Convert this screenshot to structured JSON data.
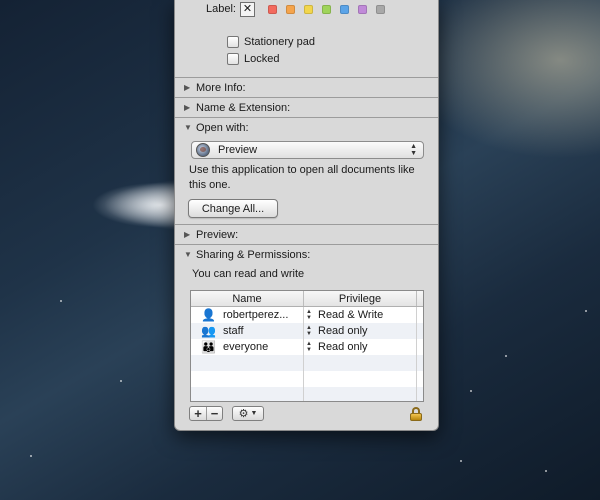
{
  "general": {
    "label_text": "Label:",
    "label_none_glyph": "✕",
    "label_colors": [
      "#f36a5e",
      "#f5a44c",
      "#f2d64c",
      "#9fd45a",
      "#5ba4e8",
      "#c08ad8",
      "#a8a8a8"
    ],
    "stationery_pad": "Stationery pad",
    "locked": "Locked"
  },
  "sections": {
    "more_info": "More Info:",
    "name_extension": "Name & Extension:",
    "open_with": "Open with:",
    "preview": "Preview:",
    "sharing": "Sharing & Permissions:"
  },
  "open_with": {
    "app": "Preview",
    "description": "Use this application to open all documents like this one.",
    "change_all": "Change All..."
  },
  "sharing": {
    "status": "You can read and write",
    "columns": [
      "Name",
      "Privilege"
    ],
    "rows": [
      {
        "name": "robertperez...",
        "privilege": "Read & Write",
        "icon": "single-user-icon"
      },
      {
        "name": "staff",
        "privilege": "Read only",
        "icon": "group-icon"
      },
      {
        "name": "everyone",
        "privilege": "Read only",
        "icon": "everyone-icon"
      }
    ],
    "add_label": "+",
    "remove_label": "−",
    "gear_label": "⚙",
    "lock_icon": "lock-icon"
  }
}
